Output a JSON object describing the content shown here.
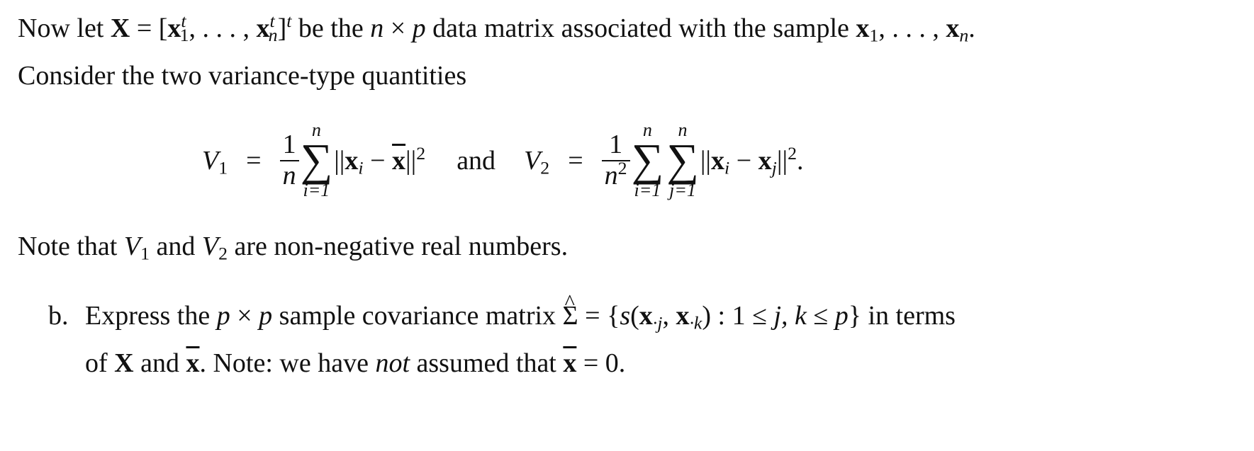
{
  "paragraph1": {
    "prefix": "Now let ",
    "X": "X",
    "eq_open": " = [",
    "x": "x",
    "sup_t": "t",
    "sub_1": "1",
    "ellipsis": ", . . . , ",
    "sub_n": "n",
    "close": "]",
    "after": " be the ",
    "n": "n",
    "times": " × ",
    "p": "p",
    "middle": " data matrix associated with the sample ",
    "sample_sep": ", . . . , ",
    "end": "."
  },
  "paragraph2": {
    "text": "Consider the two variance-type quantities"
  },
  "equation": {
    "V": "V",
    "sub1": "1",
    "sub2": "2",
    "equals": "=",
    "one": "1",
    "n": "n",
    "n2_sup": "2",
    "sum_symbol": "∑",
    "sum_top": "n",
    "sum_bot_i": "i=1",
    "sum_bot_j": "j=1",
    "norm_open": "||",
    "x": "x",
    "i": "i",
    "j": "j",
    "minus": " − ",
    "xbar": "x",
    "norm_close": "||",
    "sq": "2",
    "and": "and",
    "period": "."
  },
  "paragraph3": {
    "prefix": "Note that ",
    "V": "V",
    "sub1": "1",
    "and": " and ",
    "sub2": "2",
    "suffix": " are non-negative real numbers."
  },
  "item_b": {
    "label": "b.",
    "line1_prefix": "Express the ",
    "p": "p",
    "times": " × ",
    "line1_mid": " sample covariance matrix ",
    "Sigma": "Σ",
    "eq_set": " = {",
    "s": "s",
    "paren_open": "(",
    "x": "x",
    "sub_j": "·j",
    "comma": ", ",
    "sub_k": "·k",
    "paren_close": ")",
    "colon": " : 1 ≤ ",
    "jk": "j, k",
    "le": " ≤ ",
    "set_close": "}",
    "line1_suffix": " in terms",
    "line2_prefix": "of ",
    "X": "X",
    "and": " and ",
    "xbar": "x",
    "line2_mid": ". Note: we have ",
    "not": "not",
    "line2_mid2": " assumed that ",
    "eq_zero": " = 0."
  }
}
